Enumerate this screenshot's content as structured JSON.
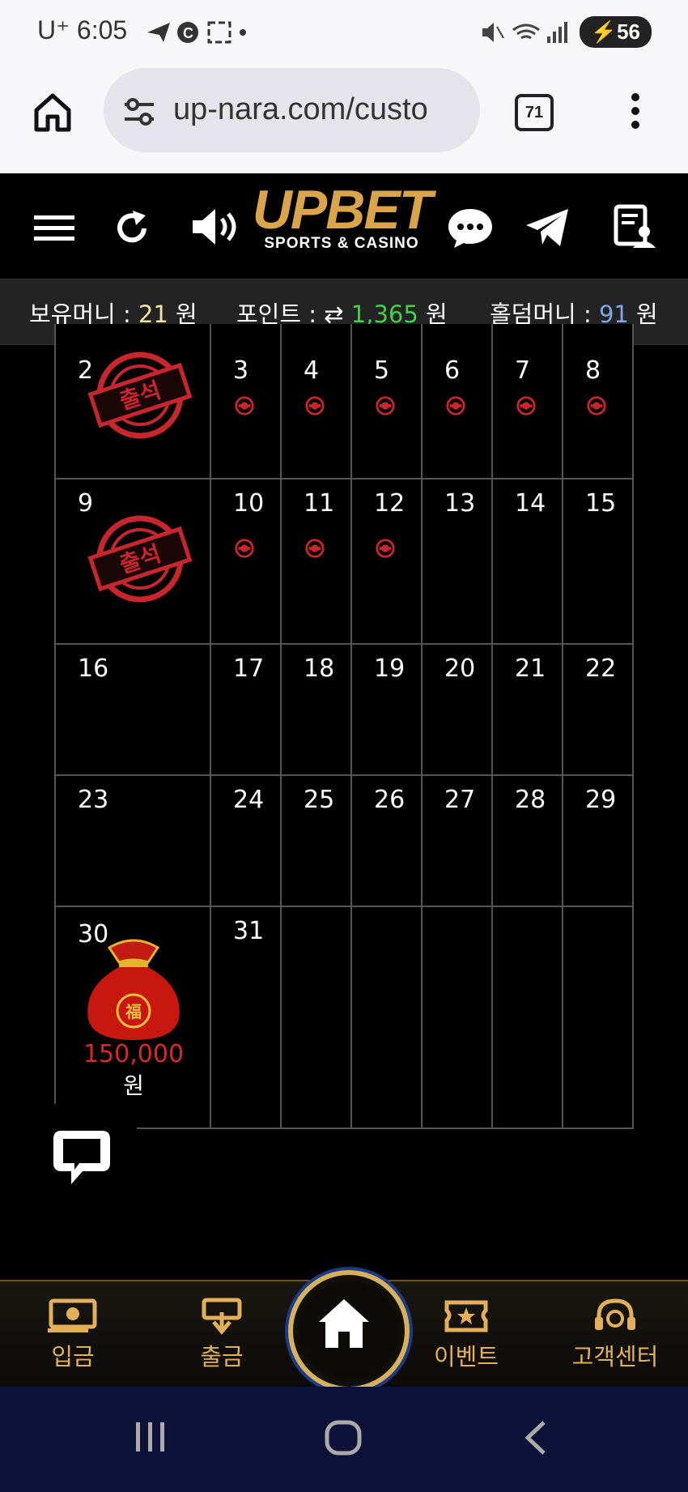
{
  "status": {
    "carrier_time": "U⁺ 6:05",
    "battery": "56",
    "icons": [
      "telegram-icon",
      "c-icon",
      "screenshot-icon",
      "dot",
      "mute-icon",
      "wifi-icon",
      "signal-icon"
    ]
  },
  "browser": {
    "url": "up-nara.com/custo",
    "tab_count": "71"
  },
  "site": {
    "logo": "UPBET",
    "logo_sub": "SPORTS & CASINO"
  },
  "balance": {
    "money_label": "보유머니 : ",
    "money_value": "21",
    "money_unit": " 원",
    "point_label": "포인트 : ",
    "point_value": "1,365",
    "point_unit": " 원",
    "holdem_label": "홀덤머니 : ",
    "holdem_value": "91",
    "holdem_unit": " 원"
  },
  "calendar": {
    "rows": [
      [
        "2",
        "3",
        "4",
        "5",
        "6",
        "7",
        "8"
      ],
      [
        "9",
        "10",
        "11",
        "12",
        "13",
        "14",
        "15"
      ],
      [
        "16",
        "17",
        "18",
        "19",
        "20",
        "21",
        "22"
      ],
      [
        "23",
        "24",
        "25",
        "26",
        "27",
        "28",
        "29"
      ],
      [
        "30",
        "31",
        "",
        "",
        "",
        "",
        ""
      ]
    ],
    "stamp_text": "출석",
    "reward_amount": "150,000",
    "reward_unit": "원"
  },
  "bottom_nav": {
    "deposit": "입금",
    "withdraw": "출금",
    "event": "이벤트",
    "support": "고객센터"
  },
  "colors": {
    "gold": "#e3b05a",
    "point_green": "#3fd24a",
    "holdem_blue": "#7fa6e6",
    "money_yellow": "#f2e6a2",
    "stamp_red": "#c8262d"
  }
}
